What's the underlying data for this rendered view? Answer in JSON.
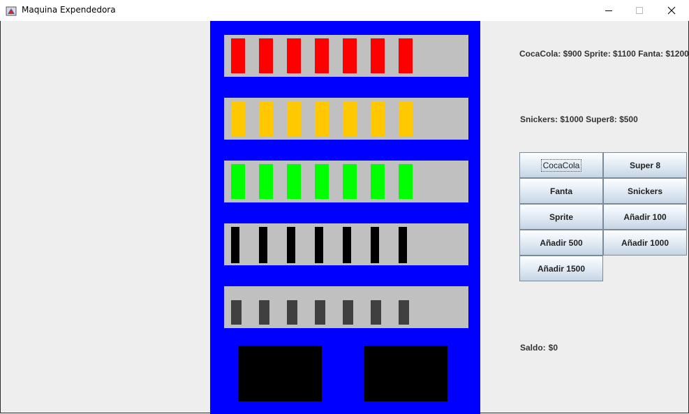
{
  "window": {
    "title": "Maquina Expendedora",
    "icon": "java-app-icon",
    "controls": [
      "minimize-icon",
      "maximize-icon",
      "close-icon"
    ]
  },
  "machine": {
    "body_color": "#0000ff",
    "shelf_color": "#c0c0c0",
    "shelves": [
      {
        "product": "CocaCola",
        "color": "#ff0000",
        "count": 7
      },
      {
        "product": "Fanta",
        "color": "#ffc800",
        "count": 7
      },
      {
        "product": "Sprite",
        "color": "#00ff00",
        "count": 7
      },
      {
        "product": "Snickers",
        "color": "#000000",
        "count": 7
      },
      {
        "product": "Super 8",
        "color": "#404040",
        "count": 7
      }
    ]
  },
  "prices": {
    "line1": "CocaCola: $900 Sprite: $1100 Fanta: $1200",
    "line2": "Snickers: $1000 Super8: $500"
  },
  "buttons": {
    "cocacola": "CocaCola",
    "super8": "Super 8",
    "fanta": "Fanta",
    "snickers": "Snickers",
    "sprite": "Sprite",
    "add100": "Añadir 100",
    "add500": "Añadir 500",
    "add1000": "Añadir 1000",
    "add1500": "Añadir 1500"
  },
  "balance": {
    "label": "Saldo:",
    "value": "$0"
  }
}
